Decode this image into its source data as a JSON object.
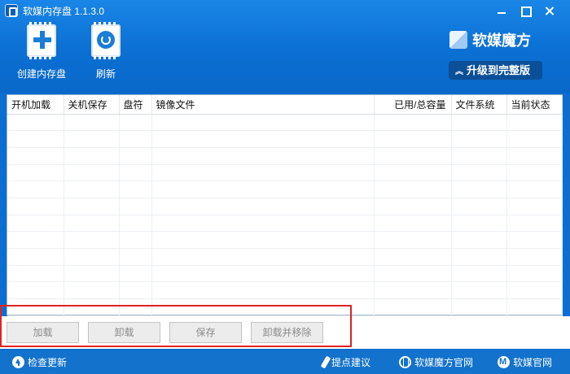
{
  "window": {
    "title": "软媒内存盘 1.1.3.0"
  },
  "toolbar": {
    "create_label": "创建内存盘",
    "refresh_label": "刷新"
  },
  "brand": {
    "name": "软媒魔方",
    "upgrade_label": "升级到完整版"
  },
  "table": {
    "columns": [
      "开机加载",
      "关机保存",
      "盘符",
      "镜像文件",
      "已用/总容量",
      "文件系统",
      "当前状态"
    ],
    "rows": []
  },
  "actions": {
    "load_label": "加载",
    "unload_label": "卸载",
    "save_label": "保存",
    "unload_remove_label": "卸载并移除"
  },
  "status_bar": {
    "check_update": "检查更新",
    "suggest": "提点建议",
    "mofang_site": "软媒魔方官网",
    "official_site": "软媒官网"
  },
  "colors": {
    "accent": "#0b6fd3",
    "status_bar": "#1272cc",
    "highlight": "#e0231f"
  }
}
